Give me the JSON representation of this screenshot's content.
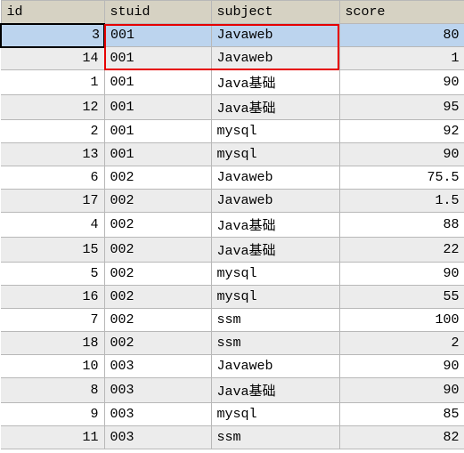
{
  "chart_data": {
    "type": "table",
    "columns": [
      "id",
      "stuid",
      "subject",
      "score"
    ],
    "rows": [
      {
        "id": 3,
        "stuid": "001",
        "subject": "Javaweb",
        "score": 80
      },
      {
        "id": 14,
        "stuid": "001",
        "subject": "Javaweb",
        "score": 1
      },
      {
        "id": 1,
        "stuid": "001",
        "subject": "Java基础",
        "score": 90
      },
      {
        "id": 12,
        "stuid": "001",
        "subject": "Java基础",
        "score": 95
      },
      {
        "id": 2,
        "stuid": "001",
        "subject": "mysql",
        "score": 92
      },
      {
        "id": 13,
        "stuid": "001",
        "subject": "mysql",
        "score": 90
      },
      {
        "id": 6,
        "stuid": "002",
        "subject": "Javaweb",
        "score": 75.5
      },
      {
        "id": 17,
        "stuid": "002",
        "subject": "Javaweb",
        "score": 1.5
      },
      {
        "id": 4,
        "stuid": "002",
        "subject": "Java基础",
        "score": 88
      },
      {
        "id": 15,
        "stuid": "002",
        "subject": "Java基础",
        "score": 22
      },
      {
        "id": 5,
        "stuid": "002",
        "subject": "mysql",
        "score": 90
      },
      {
        "id": 16,
        "stuid": "002",
        "subject": "mysql",
        "score": 55
      },
      {
        "id": 7,
        "stuid": "002",
        "subject": "ssm",
        "score": 100
      },
      {
        "id": 18,
        "stuid": "002",
        "subject": "ssm",
        "score": 2
      },
      {
        "id": 10,
        "stuid": "003",
        "subject": "Javaweb",
        "score": 90
      },
      {
        "id": 8,
        "stuid": "003",
        "subject": "Java基础",
        "score": 90
      },
      {
        "id": 9,
        "stuid": "003",
        "subject": "mysql",
        "score": 85
      },
      {
        "id": 11,
        "stuid": "003",
        "subject": "ssm",
        "score": 82
      }
    ]
  },
  "headers": {
    "id": "id",
    "stuid": "stuid",
    "subject": "subject",
    "score": "score"
  },
  "selected_row_index": 0,
  "highlight_columns": [
    "stuid",
    "subject"
  ],
  "highlight_row_indices": [
    0,
    1
  ]
}
